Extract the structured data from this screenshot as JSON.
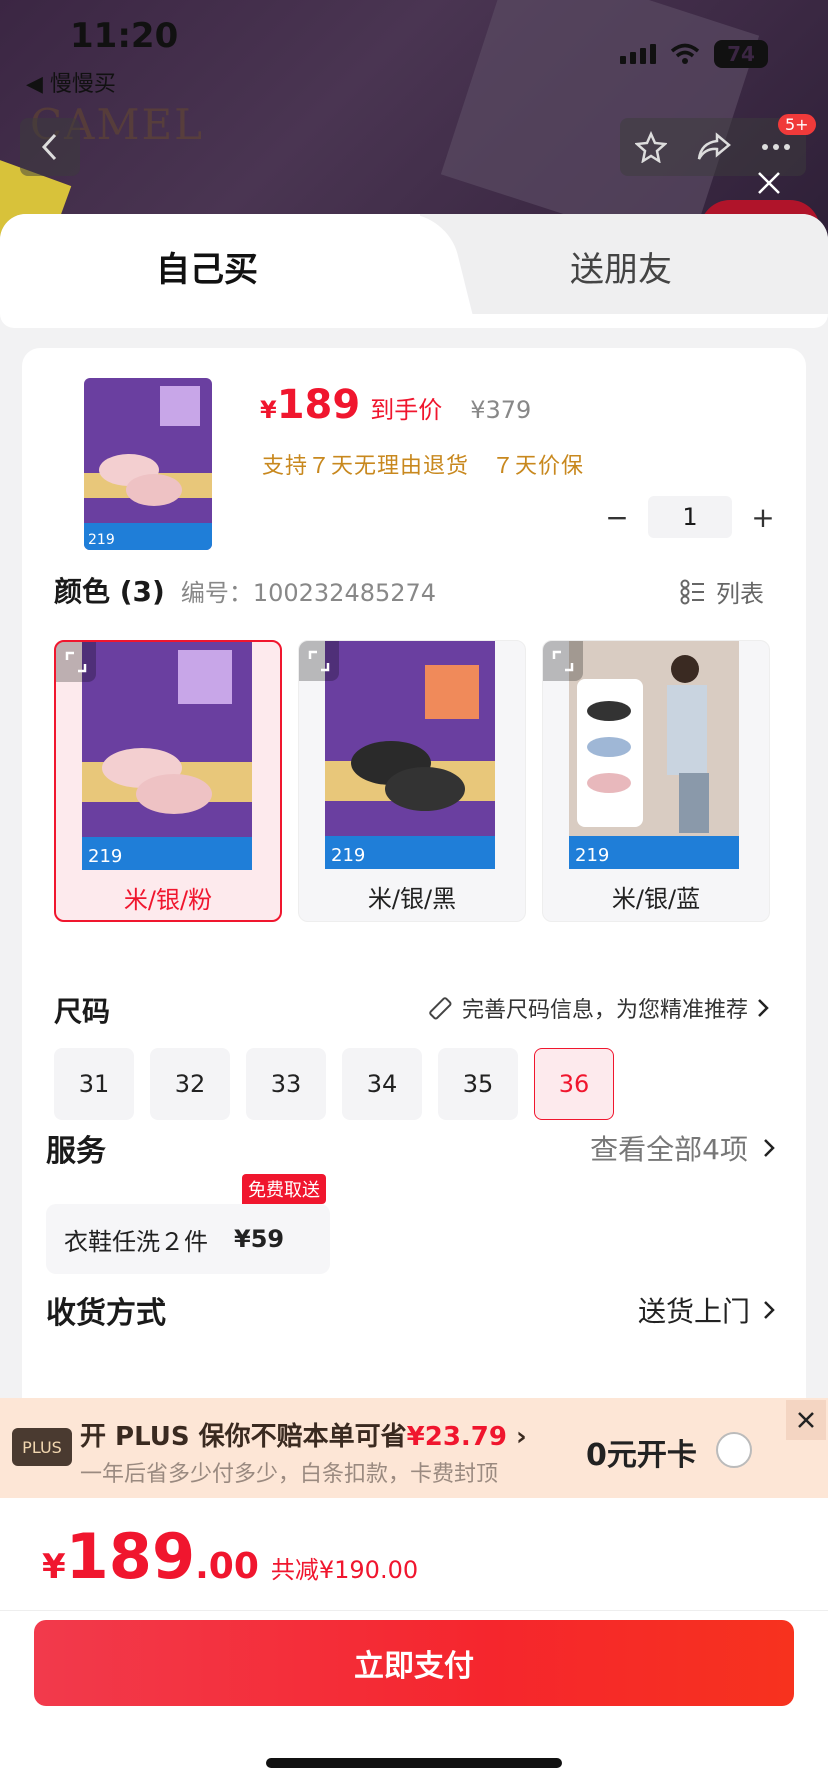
{
  "status": {
    "time": "11:20",
    "battery": "74"
  },
  "nav": {
    "back_app": "◀ 慢慢买",
    "brand": "CAMEL",
    "badge": "5+"
  },
  "tabs": {
    "self": "自己买",
    "friend": "送朋友"
  },
  "product": {
    "price_symbol": "¥",
    "price": "189",
    "price_label": "到手价",
    "original_price": "¥379",
    "promise": "支持７天无理由退货　７天价保",
    "quantity": "1"
  },
  "color": {
    "title": "颜色 (3)",
    "code": "编号：100232485274",
    "list_label": "列表",
    "options": [
      {
        "label": "米/银/粉",
        "selected": true
      },
      {
        "label": "米/银/黑",
        "selected": false
      },
      {
        "label": "米/银/蓝",
        "selected": false
      }
    ]
  },
  "size": {
    "title": "尺码",
    "tip": "完善尺码信息，为您精准推荐",
    "options": [
      "31",
      "32",
      "33",
      "34",
      "35",
      "36"
    ],
    "selected": "36"
  },
  "service": {
    "title": "服务",
    "view_all": "查看全部4项",
    "item_name": "衣鞋任洗２件",
    "item_price": "¥59",
    "tag": "免费取送"
  },
  "shipping": {
    "title": "收货方式",
    "value": "送货上门"
  },
  "plus": {
    "logo": "PLUS",
    "line1_prefix": "开 PLUS 保你不赔本单可省",
    "line1_amount": "¥23.79",
    "line1_suffix": " ›",
    "line2": "一年后省多少付多少，白条扣款，卡费封顶",
    "open": "0元开卡"
  },
  "footer": {
    "currency": "¥",
    "total_int": "189",
    "total_dec": ".00",
    "saved": "共减¥190.00",
    "pay_label": "立即支付"
  },
  "colors": {
    "accent": "#f0162e",
    "promise": "#c8881e",
    "plus_bg": "#fde6d6"
  }
}
